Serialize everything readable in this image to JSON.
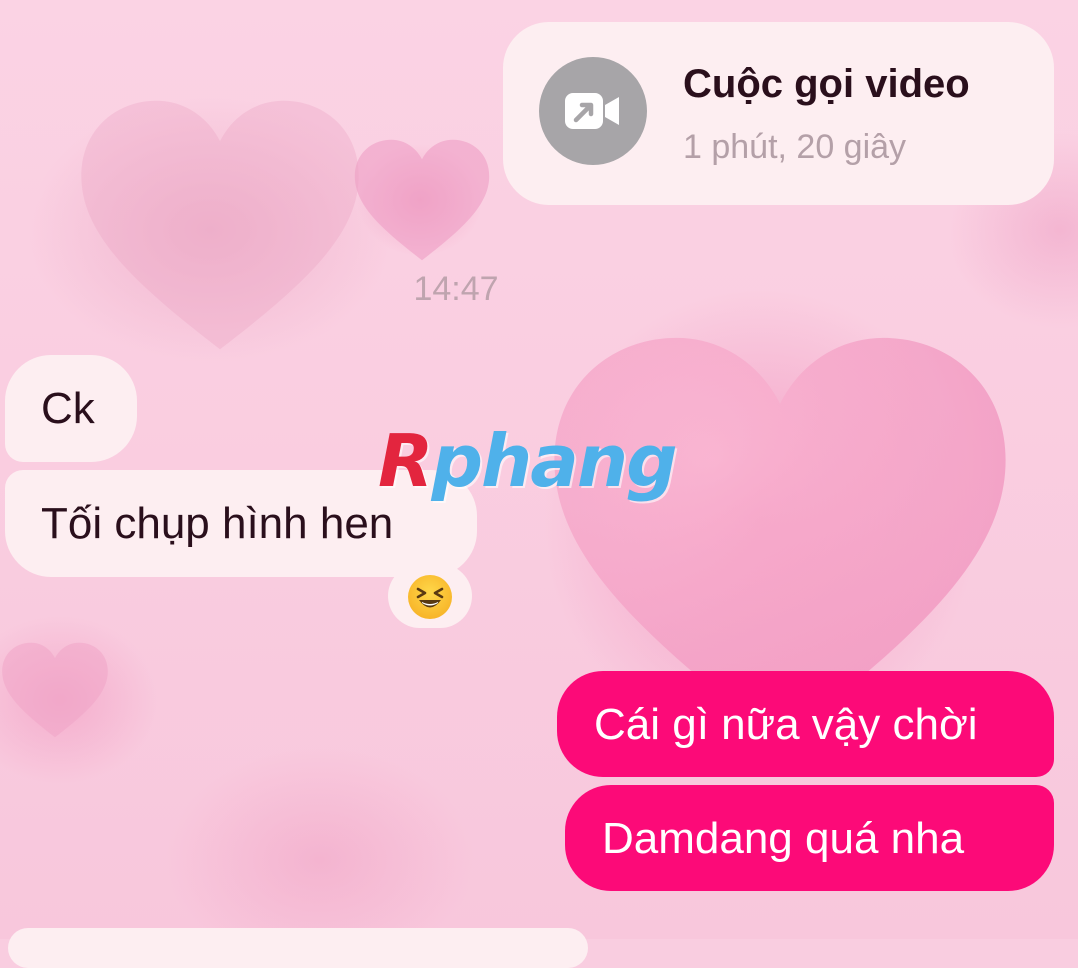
{
  "call": {
    "title": "Cuộc gọi video",
    "duration": "1 phút, 20 giây",
    "icon": "video-call-icon"
  },
  "timestamp": "14:47",
  "messages": [
    {
      "direction": "incoming",
      "text": "Ck"
    },
    {
      "direction": "incoming",
      "text": "Tối chụp hình hen"
    },
    {
      "direction": "outgoing",
      "text": "Cái gì nữa vậy chời"
    },
    {
      "direction": "outgoing",
      "text": "Damdang quá nha"
    }
  ],
  "reaction": {
    "emoji": "😆",
    "icon": "laughing-face-emoji"
  },
  "watermark": {
    "first_letter": "R",
    "rest": "phang"
  },
  "colors": {
    "background": "#f9cde0",
    "incoming_bubble": "#fdeef1",
    "outgoing_bubble": "#fc0a78",
    "incoming_text": "#2a0f1c",
    "outgoing_text": "#ffffff",
    "call_icon_bg": "#a7a5a8",
    "muted_text": "#b4a0a8"
  }
}
